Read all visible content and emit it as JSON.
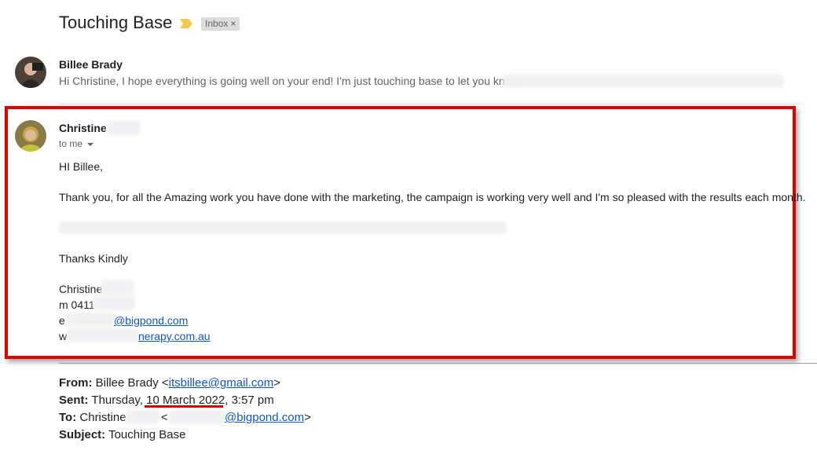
{
  "thread": {
    "subject": "Touching Base",
    "label": "Inbox",
    "label_remove": "×"
  },
  "message1": {
    "sender": "Billee Brady",
    "snippet": "Hi Christine, I hope everything is going well on your end! I'm just touching base to let you know"
  },
  "message2": {
    "sender": "Christine",
    "to": "to me",
    "greeting": "HI Billee,",
    "paragraph": "Thank you, for all the Amazing work you have done with the marketing, the campaign is working very well and I'm so pleased with the results each month.",
    "closing": "Thanks Kindly",
    "sig_name": "Christine",
    "sig_mobile": "m 0411",
    "sig_email_prefix": "e",
    "sig_email_domain": "@bigpond.com",
    "sig_web_prefix": "w",
    "sig_web_domain": "nerapy.com.au"
  },
  "quoted": {
    "from_label": "From:",
    "from_name": "Billee Brady <",
    "from_email": "itsbillee@gmail.com",
    "from_close": ">",
    "sent_label": "Sent:",
    "sent_day": "Thursday, ",
    "sent_date": "10 March 2022",
    "sent_time": ", 3:57 pm",
    "to_label": "To:",
    "to_name": "Christine",
    "to_lt": "<",
    "to_email": "@bigpond.com",
    "to_close": ">",
    "subject_label": "Subject:",
    "subject_value": "Touching Base"
  },
  "colors": {
    "highlight_border": "#e00000",
    "link": "#1155cc",
    "importance_marker": "#f2c94c"
  },
  "icons": [
    "importance-marker-icon",
    "close-icon",
    "chevron-down-icon"
  ]
}
